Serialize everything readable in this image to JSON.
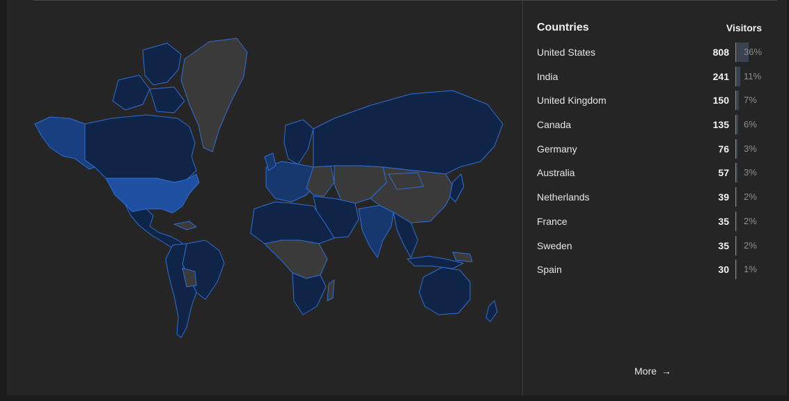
{
  "countries_panel": {
    "header_country": "Countries",
    "header_visitors": "Visitors",
    "rows": [
      {
        "name": "United States",
        "visitors": "808",
        "percent": "36%",
        "share": 0.36
      },
      {
        "name": "India",
        "visitors": "241",
        "percent": "11%",
        "share": 0.11
      },
      {
        "name": "United Kingdom",
        "visitors": "150",
        "percent": "7%",
        "share": 0.07
      },
      {
        "name": "Canada",
        "visitors": "135",
        "percent": "6%",
        "share": 0.06
      },
      {
        "name": "Germany",
        "visitors": "76",
        "percent": "3%",
        "share": 0.03
      },
      {
        "name": "Australia",
        "visitors": "57",
        "percent": "3%",
        "share": 0.03
      },
      {
        "name": "Netherlands",
        "visitors": "39",
        "percent": "2%",
        "share": 0.02
      },
      {
        "name": "France",
        "visitors": "35",
        "percent": "2%",
        "share": 0.02
      },
      {
        "name": "Sweden",
        "visitors": "35",
        "percent": "2%",
        "share": 0.02
      },
      {
        "name": "Spain",
        "visitors": "30",
        "percent": "1%",
        "share": 0.01
      }
    ],
    "more_label": "More",
    "more_icon": "arrow-right-icon"
  },
  "colors": {
    "background": "#252525",
    "map_no_data": "#3a3a3a",
    "map_low": "#0f2447",
    "map_mid": "#16386e",
    "map_high": "#1e4fa0",
    "map_border": "#2f6fd6"
  }
}
